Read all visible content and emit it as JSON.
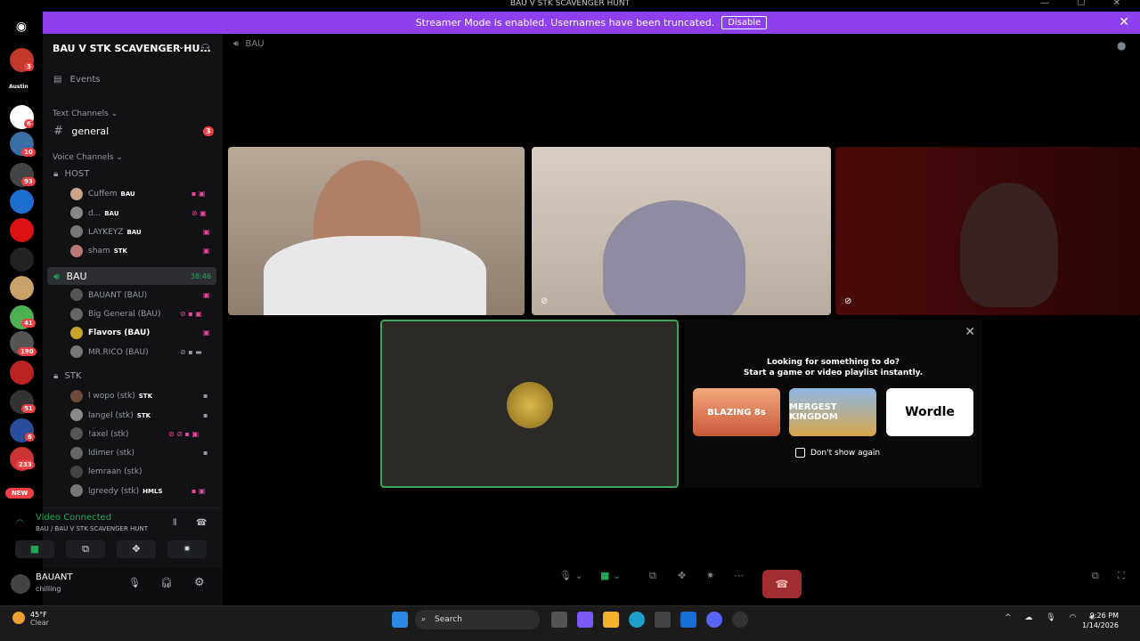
{
  "window": {
    "title": "BAU V STK SCAVENGER HUNT"
  },
  "banner": {
    "text": "Streamer Mode is enabled. Usernames have been truncated.",
    "button": "Disable"
  },
  "servers": {
    "badges": [
      "3",
      "6",
      "10",
      "93",
      "41",
      "190",
      "51",
      "6",
      "233"
    ],
    "new_label": "NEW",
    "austin_label": "Austin"
  },
  "guild": {
    "name": "BAU V STK SCAVENGER HU...",
    "events": "Events"
  },
  "categories": {
    "text": "Text Channels",
    "voice": "Voice Channels"
  },
  "text_channels": [
    {
      "name": "general",
      "badge": "3"
    }
  ],
  "voice": {
    "host": {
      "name": "HOST",
      "members": [
        {
          "name": "Cuffem",
          "tag": "BAU"
        },
        {
          "name": "d...",
          "tag": "BAU"
        },
        {
          "name": "LAYKEYZ",
          "tag": "BAU"
        },
        {
          "name": "sham",
          "tag": "STK"
        }
      ]
    },
    "bau": {
      "name": "BAU",
      "timer": "38:46",
      "members": [
        {
          "name": "BAUANT (BAU)"
        },
        {
          "name": "Big General (BAU)"
        },
        {
          "name": "Flavors (BAU)"
        },
        {
          "name": "MR.RICO (BAU)"
        }
      ]
    },
    "stk": {
      "name": "STK",
      "members": [
        {
          "name": "l wopo (stk)",
          "tag": "STK"
        },
        {
          "name": "langel (stk)",
          "tag": "STK"
        },
        {
          "name": "!axel (stk)",
          "tag": ""
        },
        {
          "name": "ldimer (stk)",
          "tag": ""
        },
        {
          "name": "lemraan (stk)",
          "tag": ""
        },
        {
          "name": "lgreedy (stk)",
          "tag": "HMLS"
        }
      ]
    }
  },
  "connection": {
    "status": "Video Connected",
    "location": "BAU / BAU V STK SCAVENGER HUNT"
  },
  "user": {
    "name": "BAUANT",
    "status": "chilling"
  },
  "call": {
    "channel": "BAU"
  },
  "activity": {
    "line1": "Looking for something to do?",
    "line2": "Start a game or video playlist instantly.",
    "games": [
      "BLAZING 8s",
      "MERGEST KINGDOM",
      "Wordle"
    ],
    "dont_show": "Don't show again"
  },
  "taskbar": {
    "weather_temp": "45°F",
    "weather_desc": "Clear",
    "search": "Search",
    "time": "9:26 PM",
    "date": "1/14/2026"
  },
  "colors": {
    "banner": "#8e3ff0",
    "accent_green": "#23a559",
    "end_call": "#a12d30"
  }
}
